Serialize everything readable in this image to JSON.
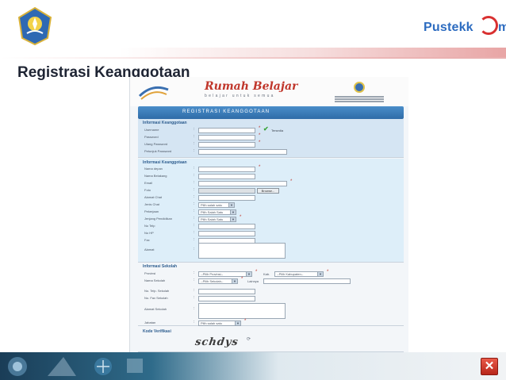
{
  "slide": {
    "title": "Registrasi Keanggotaan",
    "brand_right": "Pustekk",
    "brand_right_suffix": "m",
    "close_icon": "close-icon",
    "colors": {
      "accent": "#2d6cc0",
      "close": "#c93a2c",
      "banner": "#3a7bb8",
      "section": "#d5e5f3"
    }
  },
  "site": {
    "logo": "Rumah Belajar",
    "tagline": "belajar untuk semua",
    "banner": "REGISTRASI KEANGGOTAAN"
  },
  "form": {
    "account": {
      "title": "Informasi Keanggotaan",
      "fields": [
        "Username",
        "Password",
        "Ulang Password",
        "Petunjuk Password"
      ],
      "available": "Tersedia"
    },
    "member": {
      "title": "Informasi Keanggotaan",
      "fields": [
        "Nama depan",
        "Nama Belakang",
        "Email",
        "Foto",
        "Alamat Chat",
        "Jenis Chat",
        "Pekerjaan",
        "Jenjang Pendidikan",
        "No Telp",
        "No HP",
        "Fax",
        "Alamat"
      ],
      "browse_label": "Browse...",
      "chat_option": "Pilih salah satu",
      "job_option": "Pilih Salah Satu",
      "edu_option": "Pilih Salah Satu"
    },
    "school": {
      "title": "Informasi Sekolah",
      "fields": [
        "Provinsi",
        "Nama Sekolah",
        "No. Telp. Sekolah",
        "No. Fax Sekolah",
        "Alamat Sekolah",
        "Jabatan"
      ],
      "province_option": "--Pilih Provinsi--",
      "city_label": "Kab.",
      "city_option": "--Pilih Kabupaten--",
      "school_option": "--Pilih Sekolah--",
      "other_label": "Lainnya",
      "position_option": "Pilih salah satu"
    },
    "verify": {
      "title": "Kode Verifikasi",
      "captcha": "schdys"
    }
  }
}
